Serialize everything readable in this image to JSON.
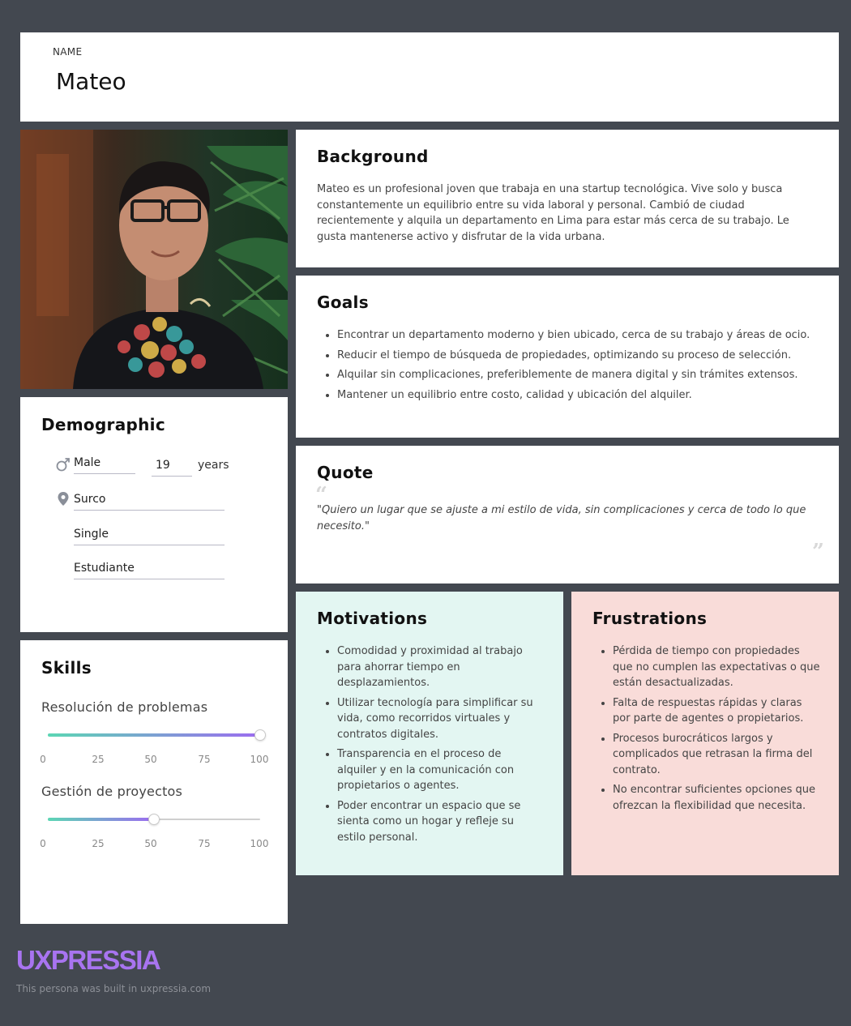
{
  "name_card": {
    "label": "NAME",
    "value": "Mateo"
  },
  "demographic": {
    "title": "Demographic",
    "gender": "Male",
    "age": "19",
    "age_unit": "years",
    "location": "Surco",
    "status": "Single",
    "occupation": "Estudiante",
    "icons": {
      "gender": "male-icon",
      "location": "location-pin-icon"
    }
  },
  "skills": {
    "title": "Skills",
    "ticks": [
      "0",
      "25",
      "50",
      "75",
      "100"
    ],
    "items": [
      {
        "label": "Resolución de problemas",
        "value": 100
      },
      {
        "label": "Gestión de proyectos",
        "value": 50
      }
    ]
  },
  "background": {
    "title": "Background",
    "text": "Mateo es un profesional joven que trabaja en una startup tecnológica. Vive solo y busca constantemente un equilibrio entre su vida laboral y personal. Cambió de ciudad recientemente y alquila un departamento en Lima para estar más cerca de su trabajo. Le gusta mantenerse activo y disfrutar de la vida urbana."
  },
  "goals": {
    "title": "Goals",
    "items": [
      "Encontrar un departamento moderno y bien ubicado, cerca de su trabajo y áreas de ocio.",
      "Reducir el tiempo de búsqueda de propiedades, optimizando su proceso de selección.",
      "Alquilar sin complicaciones, preferiblemente de manera digital y sin trámites extensos.",
      "Mantener un equilibrio entre costo, calidad y ubicación del alquiler."
    ]
  },
  "quote": {
    "title": "Quote",
    "text": "\"Quiero un lugar que se ajuste a mi estilo de vida, sin complicaciones y cerca de todo lo que necesito.\""
  },
  "motivations": {
    "title": "Motivations",
    "items": [
      "Comodidad y proximidad al trabajo para ahorrar tiempo en desplazamientos.",
      "Utilizar tecnología para simplificar su vida, como recorridos virtuales y contratos digitales.",
      "Transparencia en el proceso de alquiler y en la comunicación con propietarios o agentes.",
      "Poder encontrar un espacio que se sienta como un hogar y refleje su estilo personal."
    ]
  },
  "frustrations": {
    "title": "Frustrations",
    "items": [
      "Pérdida de tiempo con propiedades que no cumplen las expectativas o que están desactualizadas.",
      "Falta de respuestas rápidas y claras por parte de agentes o propietarios.",
      "Procesos burocráticos largos y complicados que retrasan la firma del contrato.",
      "No encontrar suficientes opciones que ofrezcan la flexibilidad que necesita."
    ]
  },
  "footer": {
    "brand": "UXPRESSIA",
    "built_text": "This persona was built in uxpressia.com"
  },
  "colors": {
    "page_bg": "#434850",
    "card_bg": "#ffffff",
    "motivations_bg": "#e3f6f2",
    "frustrations_bg": "#f9dcd9",
    "brand": "#a874f0",
    "slider_start": "#5cd6b4",
    "slider_end": "#9c6cf0"
  }
}
